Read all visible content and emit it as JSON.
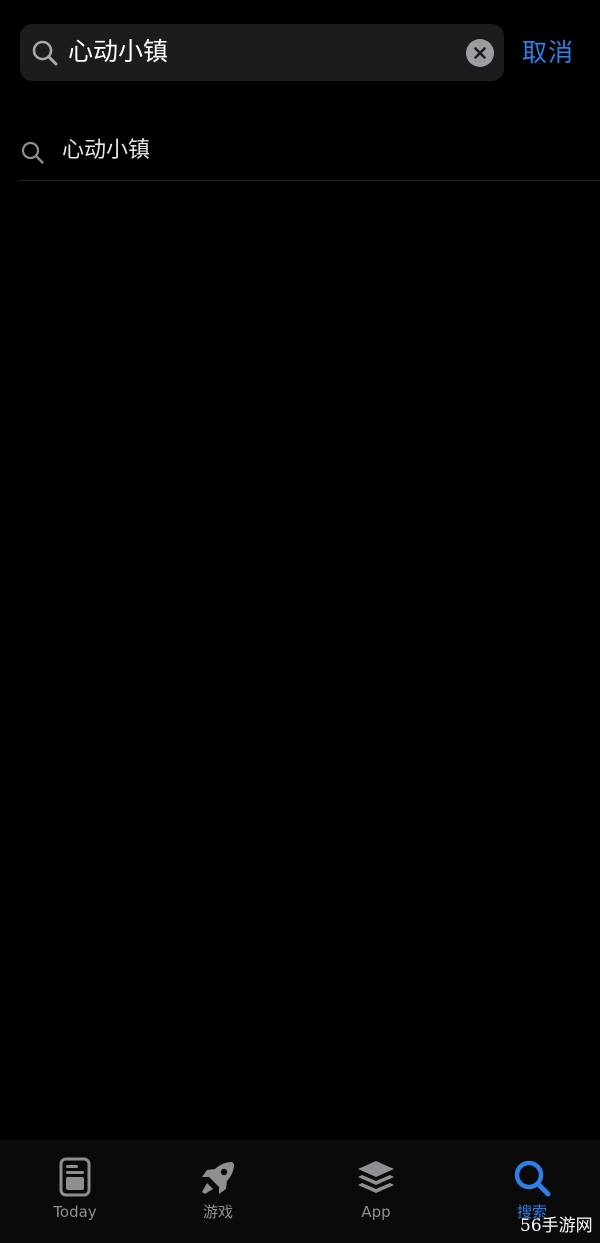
{
  "search": {
    "value": "心动小镇",
    "cancel_label": "取消"
  },
  "suggestions": [
    {
      "label": "心动小镇"
    }
  ],
  "tab_bar": {
    "tabs": [
      {
        "label": "Today",
        "icon": "today-icon",
        "active": false
      },
      {
        "label": "游戏",
        "icon": "rocket-icon",
        "active": false
      },
      {
        "label": "App",
        "icon": "app-stack-icon",
        "active": false
      },
      {
        "label": "搜索",
        "icon": "search-icon",
        "active": true
      }
    ]
  },
  "watermark": "56手游网",
  "colors": {
    "background": "#000000",
    "search_field": "#1c1c1e",
    "accent": "#2f7fe6",
    "inactive": "#8e8e93"
  }
}
